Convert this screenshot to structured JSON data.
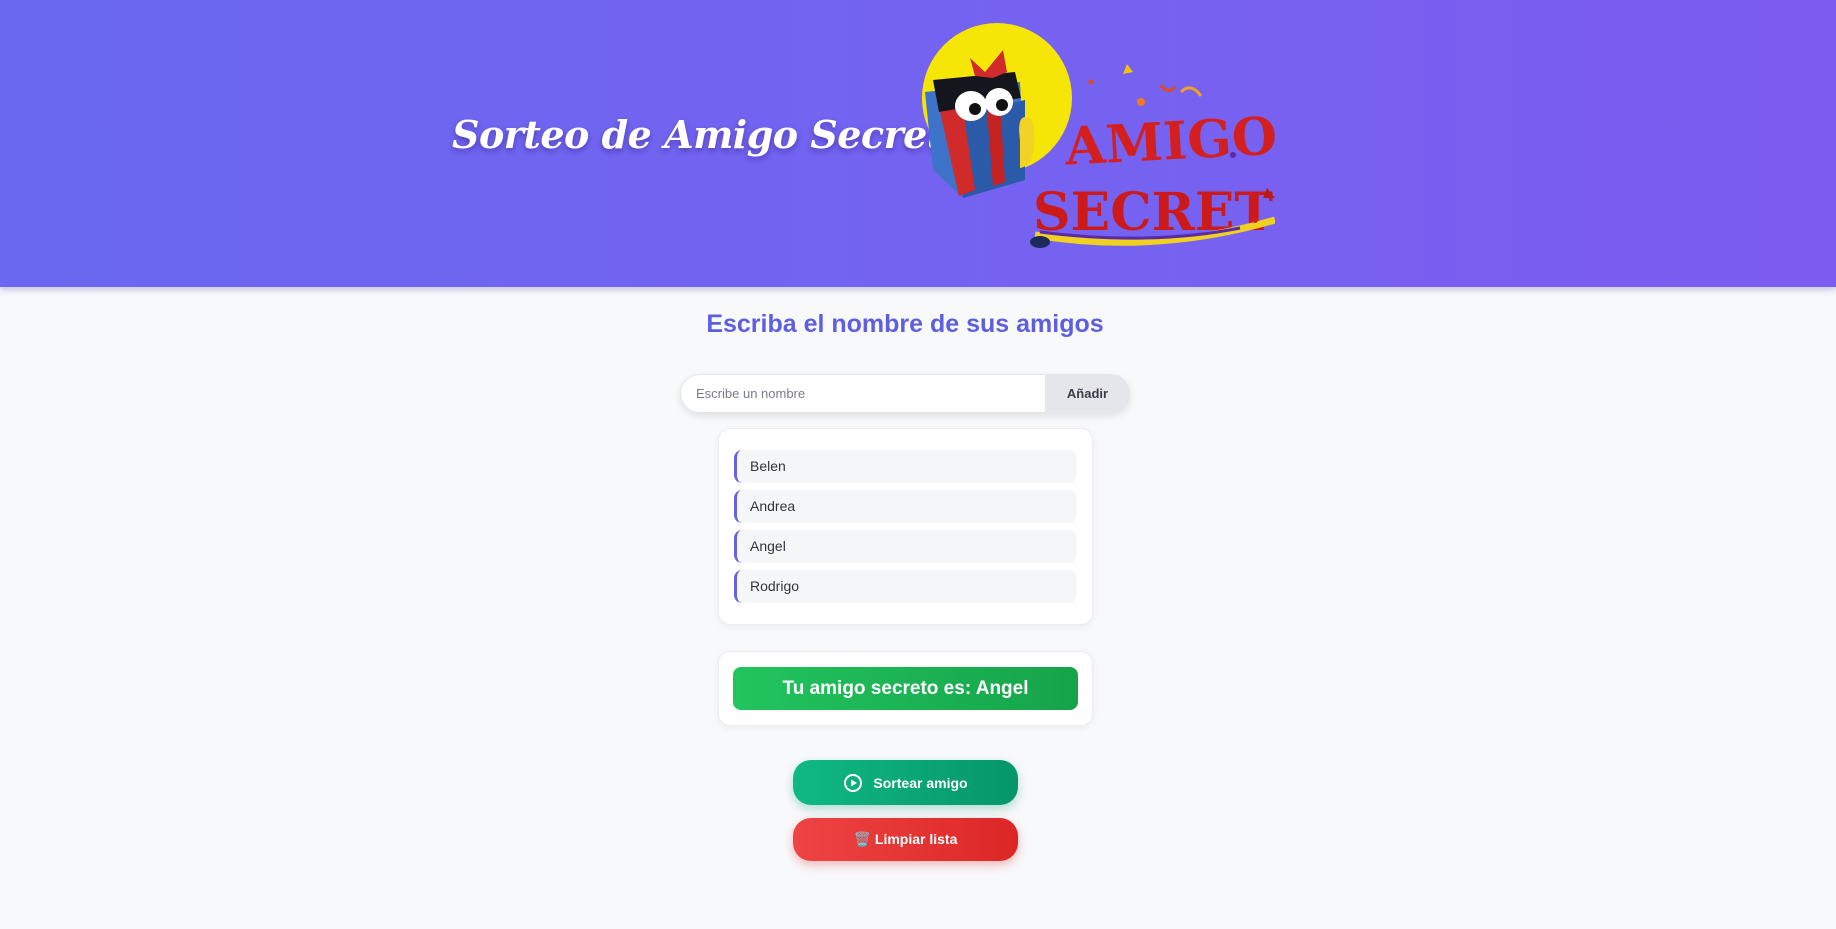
{
  "header": {
    "title": "Sorteo de Amigo Secreto",
    "logo": {
      "icon": "gift-box-mascot-icon",
      "line1": "AMIGO",
      "line2": "SECRETO"
    }
  },
  "main": {
    "heading": "Escriba el nombre de sus amigos",
    "input": {
      "placeholder": "Escribe un nombre",
      "value": ""
    },
    "add_label": "Añadir",
    "friends": [
      "Belen",
      "Andrea",
      "Angel",
      "Rodrigo"
    ],
    "result_text": "Tu amigo secreto es: Angel",
    "draw_button": {
      "icon": "play-circle-icon",
      "label": "Sortear amigo"
    },
    "clear_button": {
      "label": "🗑️ Limpiar lista"
    }
  },
  "colors": {
    "header_gradient_start": "#6a68f0",
    "header_gradient_end": "#7d5cf1",
    "accent": "#5f5ee0",
    "success": "#16a34a",
    "draw": "#059669",
    "danger": "#dc2626"
  }
}
